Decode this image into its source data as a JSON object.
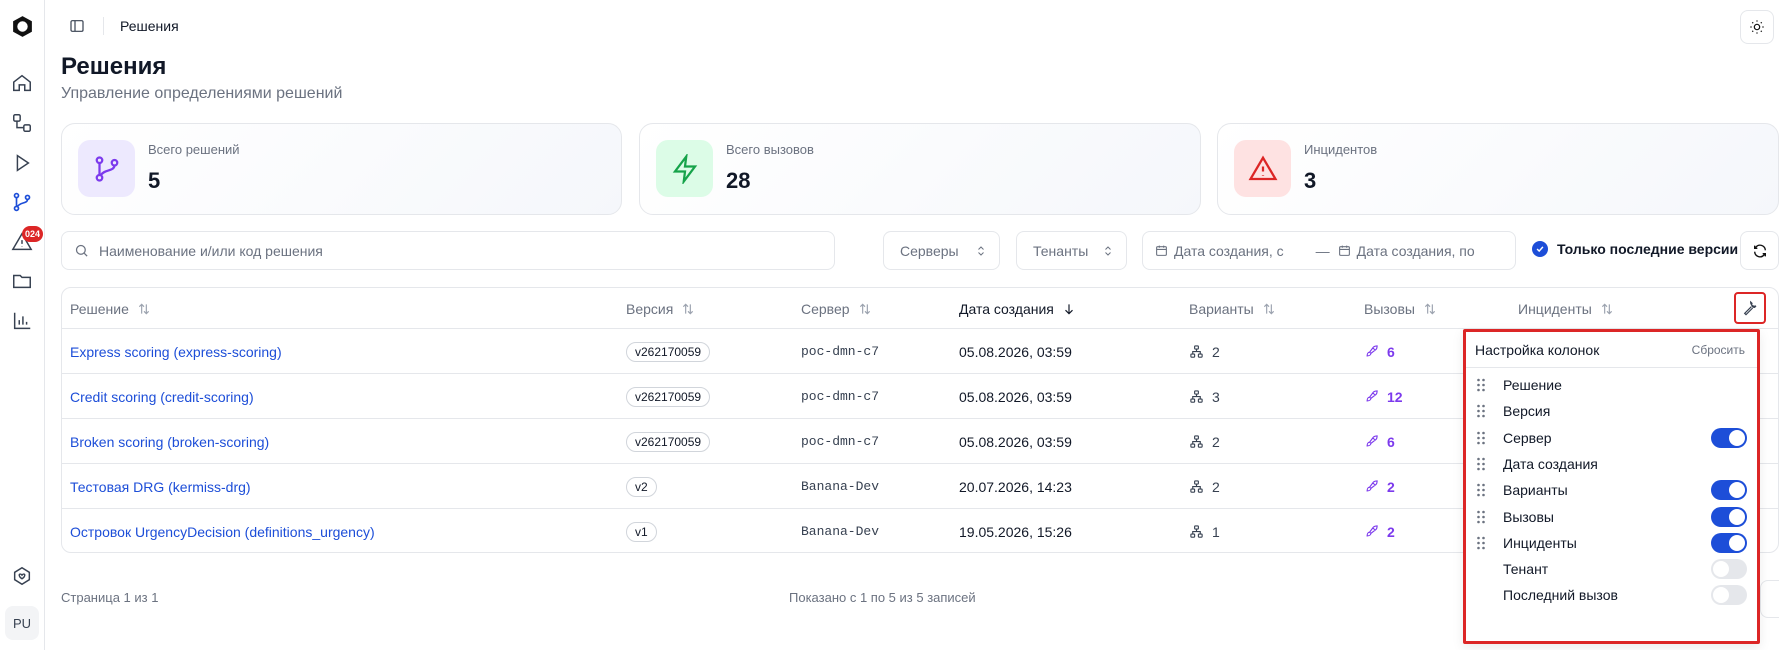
{
  "sidebar": {
    "icons": [
      "logo-icon",
      "home-icon",
      "workflow-icon",
      "play-icon",
      "branch-icon",
      "alert-icon",
      "folder-icon",
      "chart-icon",
      "health-icon"
    ],
    "badge": "024",
    "avatar": "PU"
  },
  "topbar": {
    "breadcrumb": "Решения"
  },
  "page": {
    "title": "Решения",
    "subtitle": "Управление определениями решений"
  },
  "stats": [
    {
      "label": "Всего решений",
      "value": "5",
      "icon": "branch-icon",
      "color": "#7c3aed",
      "bg": "#ede9fe"
    },
    {
      "label": "Всего вызовов",
      "value": "28",
      "icon": "lightning-icon",
      "color": "#16a34a",
      "bg": "#dcfce7"
    },
    {
      "label": "Инцидентов",
      "value": "3",
      "icon": "warning-icon",
      "color": "#dc2626",
      "bg": "#fee2e2"
    }
  ],
  "filters": {
    "search_placeholder": "Наименование и/или код решения",
    "servers": "Серверы",
    "tenants": "Тенанты",
    "date_from": "Дата создания, с",
    "date_sep": "—",
    "date_to": "Дата создания, по",
    "latest_only": "Только последние версии"
  },
  "table": {
    "columns": [
      "Решение",
      "Версия",
      "Сервер",
      "Дата создания",
      "Варианты",
      "Вызовы",
      "Инциденты"
    ],
    "rows": [
      {
        "name": "Express scoring (express-scoring)",
        "version": "v262170059",
        "server": "poc-dmn-c7",
        "created": "05.08.2026, 03:59",
        "variants": "2",
        "calls": "6"
      },
      {
        "name": "Credit scoring (credit-scoring)",
        "version": "v262170059",
        "server": "poc-dmn-c7",
        "created": "05.08.2026, 03:59",
        "variants": "3",
        "calls": "12"
      },
      {
        "name": "Broken scoring (broken-scoring)",
        "version": "v262170059",
        "server": "poc-dmn-c7",
        "created": "05.08.2026, 03:59",
        "variants": "2",
        "calls": "6"
      },
      {
        "name": "Тестовая DRG (kermiss-drg)",
        "version": "v2",
        "server": "Banana-Dev",
        "created": "20.07.2026, 14:23",
        "variants": "2",
        "calls": "2"
      },
      {
        "name": "Островок UrgencyDecision (definitions_urgency)",
        "version": "v1",
        "server": "Banana-Dev",
        "created": "19.05.2026, 15:26",
        "variants": "1",
        "calls": "2"
      }
    ]
  },
  "footer": {
    "page": "Страница 1 из 1",
    "shown": "Показано с 1 по 5 из 5 записей"
  },
  "column_settings": {
    "title": "Настройка колонок",
    "reset": "Сбросить",
    "items": [
      {
        "label": "Решение",
        "draggable": true,
        "toggle": "none"
      },
      {
        "label": "Версия",
        "draggable": true,
        "toggle": "none"
      },
      {
        "label": "Сервер",
        "draggable": true,
        "toggle": "on"
      },
      {
        "label": "Дата создания",
        "draggable": true,
        "toggle": "none"
      },
      {
        "label": "Варианты",
        "draggable": true,
        "toggle": "on"
      },
      {
        "label": "Вызовы",
        "draggable": true,
        "toggle": "on"
      },
      {
        "label": "Инциденты",
        "draggable": true,
        "toggle": "on"
      },
      {
        "label": "Тенант",
        "draggable": false,
        "toggle": "off"
      },
      {
        "label": "Последний вызов",
        "draggable": false,
        "toggle": "off"
      }
    ]
  },
  "colors": {
    "accent": "#1d4ed8",
    "purple": "#7c3aed",
    "danger": "#dc2626",
    "border": "#e5e7eb",
    "muted": "#6b7280"
  }
}
